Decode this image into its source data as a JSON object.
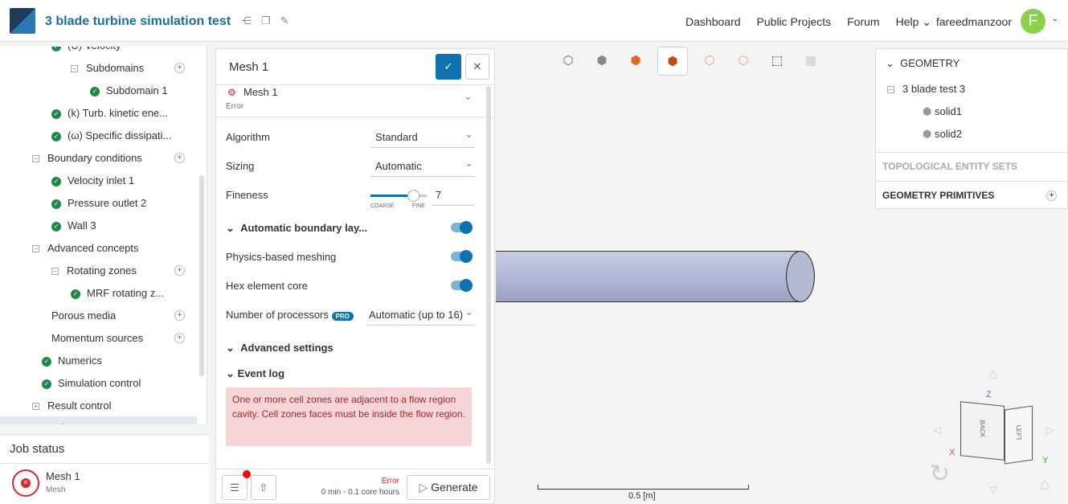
{
  "header": {
    "title": "3 blade turbine simulation test",
    "nav": [
      "Dashboard",
      "Public Projects",
      "Forum",
      "Help"
    ],
    "username": "fareedmanzoor",
    "avatar_letter": "F"
  },
  "tree": [
    {
      "label": "(U) Velocity",
      "kind": "check",
      "indent": 1
    },
    {
      "label": "Subdomains",
      "kind": "collapse",
      "indent": 2,
      "add": true
    },
    {
      "label": "Subdomain 1",
      "kind": "check",
      "indent": 3
    },
    {
      "label": "(k) Turb. kinetic ene...",
      "kind": "check",
      "indent": 1
    },
    {
      "label": "(ω) Specific dissipati...",
      "kind": "check",
      "indent": 1
    },
    {
      "label": "Boundary conditions",
      "kind": "collapse",
      "indent": 0,
      "add": true
    },
    {
      "label": "Velocity inlet 1",
      "kind": "check",
      "indent": 1
    },
    {
      "label": "Pressure outlet 2",
      "kind": "check",
      "indent": 1
    },
    {
      "label": "Wall 3",
      "kind": "check",
      "indent": 1
    },
    {
      "label": "Advanced concepts",
      "kind": "collapse",
      "indent": 0
    },
    {
      "label": "Rotating zones",
      "kind": "collapse",
      "indent": 1,
      "add": true
    },
    {
      "label": "MRF rotating z...",
      "kind": "check",
      "indent": 2
    },
    {
      "label": "Porous media",
      "kind": "none",
      "indent": 1,
      "add": true
    },
    {
      "label": "Momentum sources",
      "kind": "none",
      "indent": 1,
      "add": true
    },
    {
      "label": "Numerics",
      "kind": "check",
      "indent": 0.5
    },
    {
      "label": "Simulation control",
      "kind": "check",
      "indent": 0.5
    },
    {
      "label": "Result control",
      "kind": "expand",
      "indent": 0
    },
    {
      "label": "Mesh",
      "kind": "none",
      "indent": 0.5
    }
  ],
  "job_status": {
    "title": "Job status",
    "name": "Mesh 1",
    "type": "Mesh"
  },
  "mesh_panel": {
    "title": "Mesh 1",
    "selected_mesh": "Mesh 1",
    "selected_status": "Error",
    "algorithm_label": "Algorithm",
    "algorithm": "Standard",
    "sizing_label": "Sizing",
    "sizing": "Automatic",
    "fineness_label": "Fineness",
    "fineness": 7,
    "fineness_fraction": 0.75,
    "coarse": "COARSE",
    "fine": "FINE",
    "abl_label": "Automatic boundary lay...",
    "physics_label": "Physics-based meshing",
    "hex_label": "Hex element core",
    "proc_label": "Number of processors",
    "pro_badge": "PRO",
    "proc": "Automatic (up to 16)",
    "advanced_label": "Advanced settings",
    "event_log_label": "Event log",
    "error_message": "One or more cell zones are adjacent to a flow region cavity. Cell zones faces must be inside the flow region.",
    "status": "Error",
    "estimate": "0 min - 0.1 core hours",
    "generate": "Generate"
  },
  "viewport": {
    "scale_label": "0.5 [m]",
    "axes": {
      "x": "X",
      "y": "Y",
      "z": "Z"
    },
    "cube_faces": [
      "BACK",
      "LEFT"
    ]
  },
  "geometry_panel": {
    "title": "GEOMETRY",
    "root": "3 blade test 3",
    "items": [
      "solid1",
      "solid2"
    ],
    "sections": [
      "TOPOLOGICAL ENTITY SETS",
      "GEOMETRY PRIMITIVES"
    ]
  },
  "colors": {
    "brand": "#1a6ea6",
    "success": "#1e8a4a",
    "error": "#d9262c",
    "error_bg": "#f5d5d8"
  }
}
